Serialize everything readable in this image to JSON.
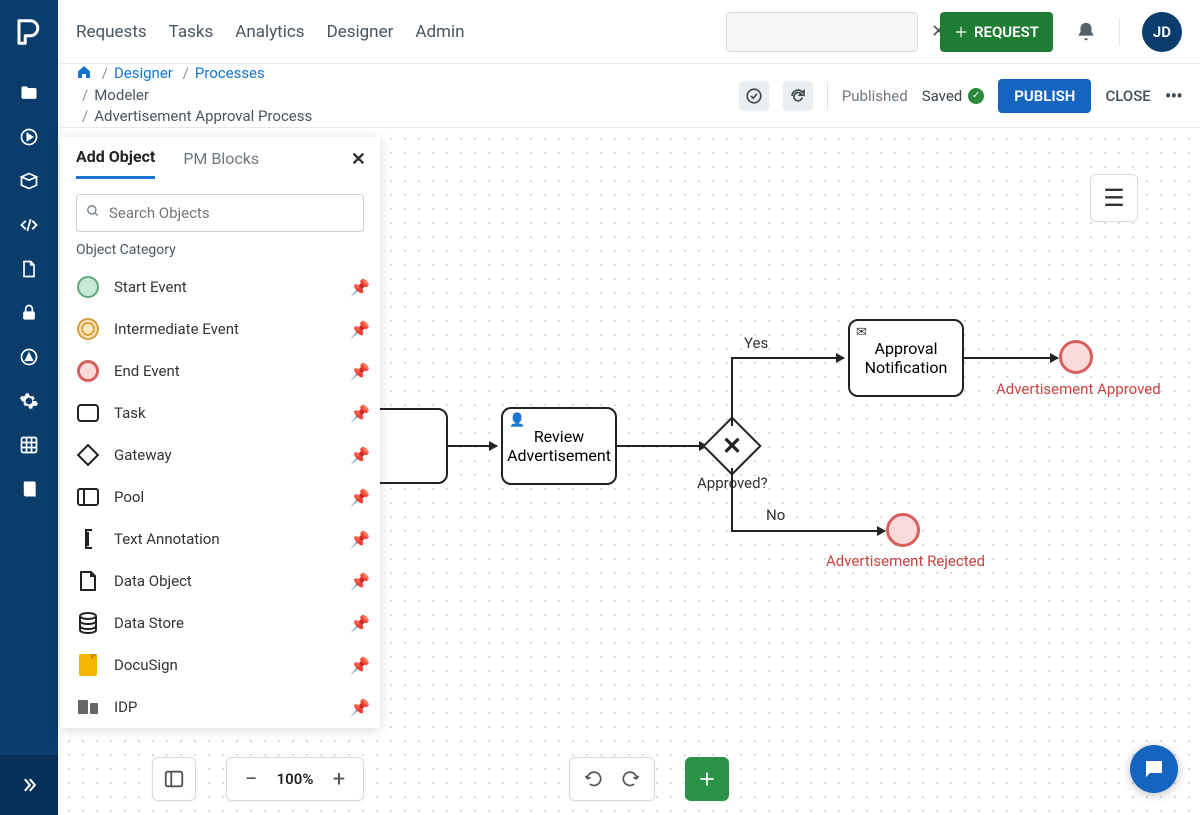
{
  "topnav": {
    "items": [
      "Requests",
      "Tasks",
      "Analytics",
      "Designer",
      "Admin"
    ]
  },
  "search": {
    "placeholder": ""
  },
  "request_btn": "REQUEST",
  "avatar": "JD",
  "breadcrumb": {
    "designer": "Designer",
    "processes": "Processes",
    "modeler": "Modeler",
    "current": "Advertisement Approval Process"
  },
  "toolbar": {
    "published": "Published",
    "saved": "Saved",
    "publish": "PUBLISH",
    "close": "CLOSE"
  },
  "panel": {
    "tab_add": "Add Object",
    "tab_blocks": "PM Blocks",
    "search_placeholder": "Search Objects",
    "section": "Object Category",
    "objects": [
      {
        "label": "Start Event"
      },
      {
        "label": "Intermediate Event"
      },
      {
        "label": "End Event"
      },
      {
        "label": "Task"
      },
      {
        "label": "Gateway"
      },
      {
        "label": "Pool"
      },
      {
        "label": "Text Annotation"
      },
      {
        "label": "Data Object"
      },
      {
        "label": "Data Store"
      },
      {
        "label": "DocuSign"
      },
      {
        "label": "IDP"
      }
    ]
  },
  "canvas": {
    "task_review": "Review Advertisement",
    "gateway_label": "Approved?",
    "yes": "Yes",
    "no": "No",
    "task_approve": "Approval Notification",
    "end_approved": "Advertisement Approved",
    "end_rejected": "Advertisement Rejected"
  },
  "bottom": {
    "zoom": "100%"
  }
}
